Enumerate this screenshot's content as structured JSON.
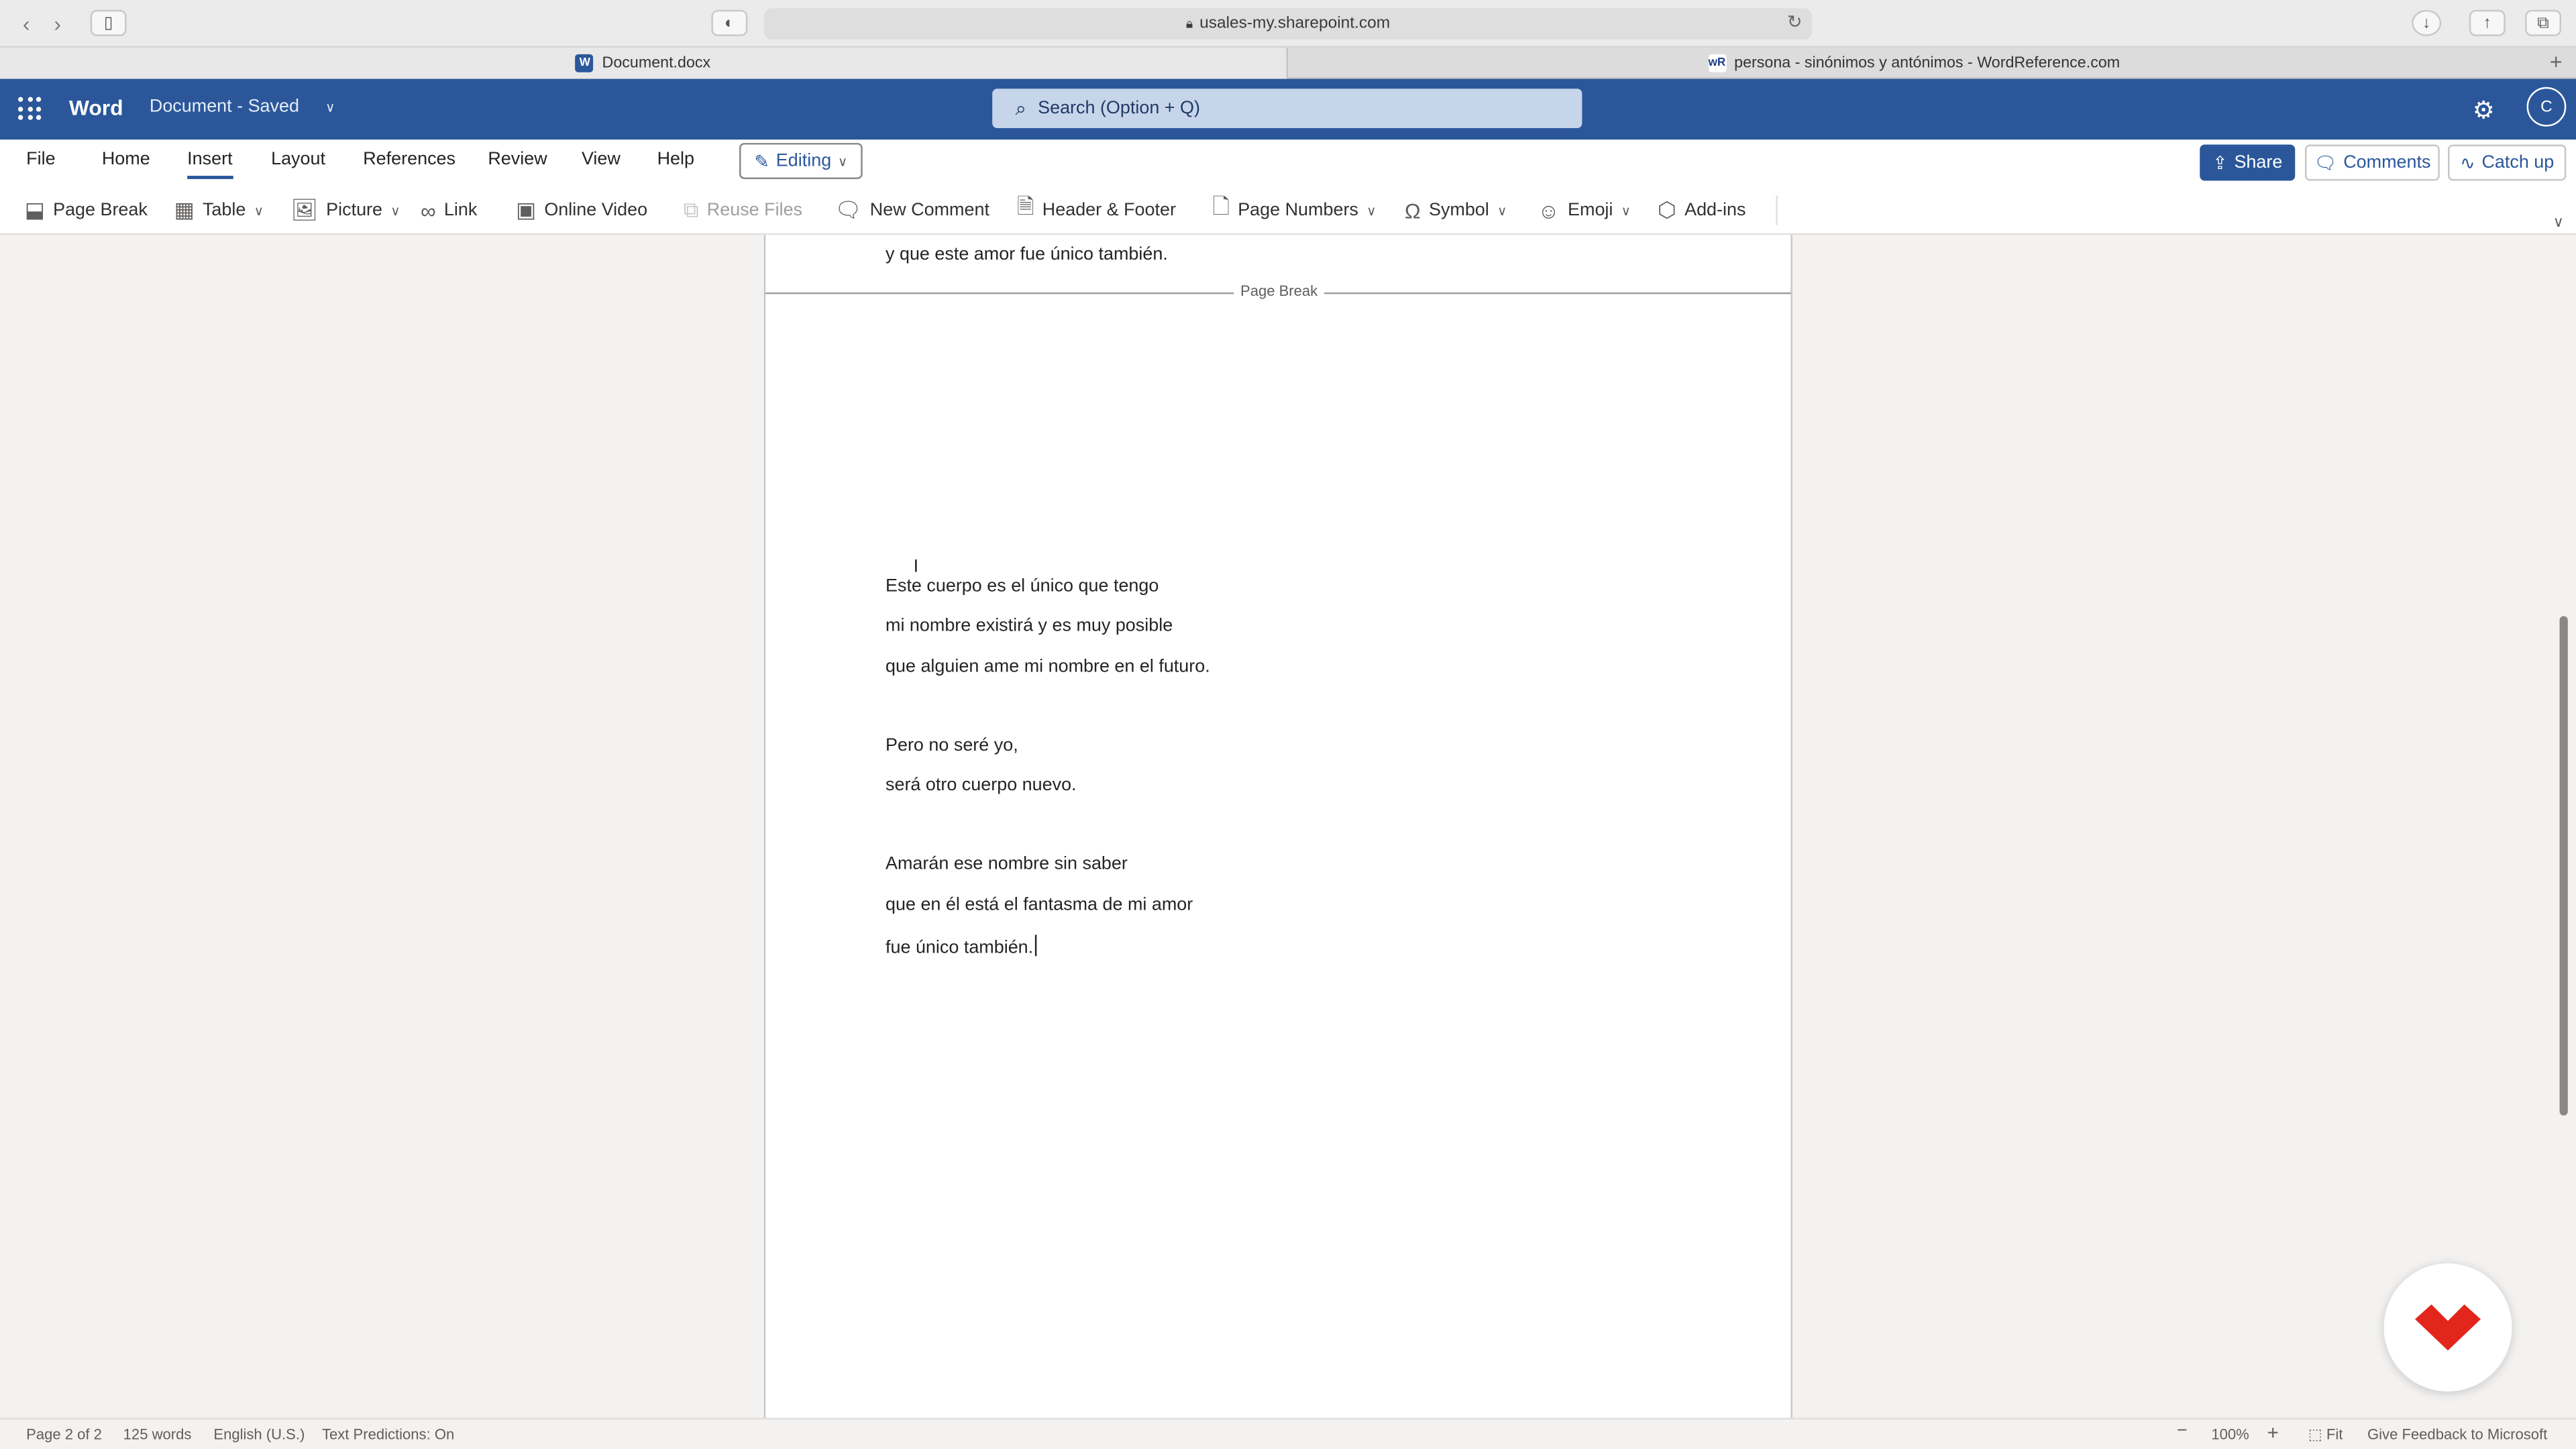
{
  "browser": {
    "url": "usales-my.sharepoint.com",
    "tabs": [
      {
        "label": "Document.docx"
      },
      {
        "label": "persona - sinónimos y antónimos - WordReference.com"
      }
    ]
  },
  "header": {
    "app_name": "Word",
    "doc_title": "Document - Saved",
    "search_placeholder": "Search (Option + Q)",
    "avatar_initial": "C"
  },
  "menu": {
    "tabs": [
      "File",
      "Home",
      "Insert",
      "Layout",
      "References",
      "Review",
      "View",
      "Help"
    ],
    "active_tab": "Insert",
    "editing_label": "Editing",
    "share_label": "Share",
    "comments_label": "Comments",
    "catchup_label": "Catch up"
  },
  "ribbon": {
    "items": [
      {
        "label": "Page Break",
        "icon": "page-break-icon"
      },
      {
        "label": "Table",
        "icon": "table-icon"
      },
      {
        "label": "Picture",
        "icon": "picture-icon"
      },
      {
        "label": "Link",
        "icon": "link-icon"
      },
      {
        "label": "Online Video",
        "icon": "online-video-icon"
      },
      {
        "label": "Reuse Files",
        "icon": "reuse-files-icon",
        "disabled": true
      },
      {
        "label": "New Comment",
        "icon": "comment-icon"
      },
      {
        "label": "Header & Footer",
        "icon": "header-footer-icon"
      },
      {
        "label": "Page Numbers",
        "icon": "page-numbers-icon"
      },
      {
        "label": "Symbol",
        "icon": "omega-icon"
      },
      {
        "label": "Emoji",
        "icon": "emoji-icon"
      },
      {
        "label": "Add-ins",
        "icon": "add-ins-icon"
      }
    ]
  },
  "document": {
    "previous_page_last_line": "y que este amor fue único también.",
    "page_break_label": "Page Break",
    "lines": [
      "Este cuerpo es el único que tengo",
      "mi nombre existirá y es muy posible",
      "que alguien ame mi nombre en el futuro.",
      "Pero no seré yo,",
      "será otro cuerpo nuevo.",
      "Amarán ese nombre sin saber",
      "que en él está el fantasma de mi amor",
      "fue único también."
    ]
  },
  "status": {
    "page": "Page 2 of 2",
    "words": "125 words",
    "language": "English (U.S.)",
    "predictions": "Text Predictions: On",
    "zoom": "100%",
    "fit": "Fit",
    "feedback": "Give Feedback to Microsoft"
  },
  "colors": {
    "word_blue": "#2b579a",
    "badge_red": "#e2261c"
  }
}
